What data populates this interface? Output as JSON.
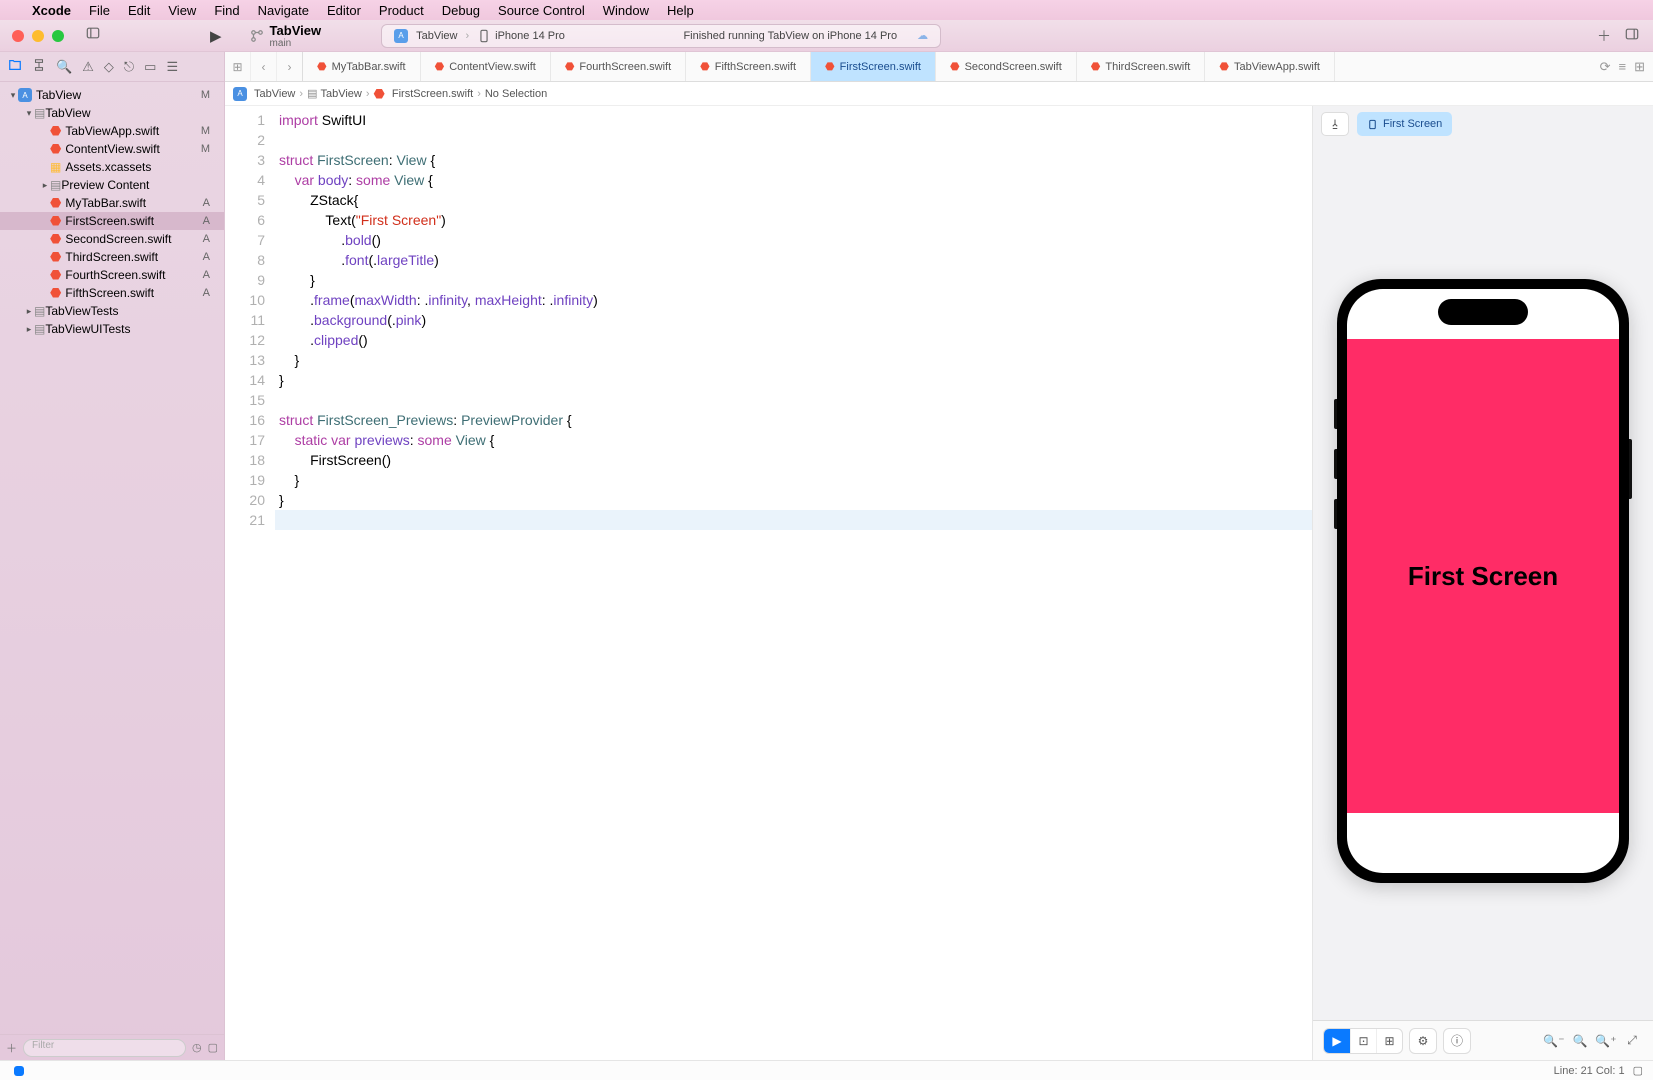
{
  "menu": {
    "app": "Xcode",
    "items": [
      "File",
      "Edit",
      "View",
      "Find",
      "Navigate",
      "Editor",
      "Product",
      "Debug",
      "Source Control",
      "Window",
      "Help"
    ]
  },
  "toolbar": {
    "scheme_name": "TabView",
    "scheme_branch": "main",
    "activity": {
      "target": "TabView",
      "device": "iPhone 14 Pro",
      "status": "Finished running TabView on iPhone 14 Pro"
    }
  },
  "navigator": {
    "tree": [
      {
        "level": 0,
        "disclosure": "▾",
        "kind": "proj",
        "name": "TabView",
        "scm": "M"
      },
      {
        "level": 1,
        "disclosure": "▾",
        "kind": "folder",
        "name": "TabView",
        "scm": ""
      },
      {
        "level": 2,
        "disclosure": "",
        "kind": "swift",
        "name": "TabViewApp.swift",
        "scm": "M"
      },
      {
        "level": 2,
        "disclosure": "",
        "kind": "swift",
        "name": "ContentView.swift",
        "scm": "M"
      },
      {
        "level": 2,
        "disclosure": "",
        "kind": "assets",
        "name": "Assets.xcassets",
        "scm": ""
      },
      {
        "level": 2,
        "disclosure": "▸",
        "kind": "folder",
        "name": "Preview Content",
        "scm": ""
      },
      {
        "level": 2,
        "disclosure": "",
        "kind": "swift",
        "name": "MyTabBar.swift",
        "scm": "A"
      },
      {
        "level": 2,
        "disclosure": "",
        "kind": "swift",
        "name": "FirstScreen.swift",
        "scm": "A",
        "selected": true
      },
      {
        "level": 2,
        "disclosure": "",
        "kind": "swift",
        "name": "SecondScreen.swift",
        "scm": "A"
      },
      {
        "level": 2,
        "disclosure": "",
        "kind": "swift",
        "name": "ThirdScreen.swift",
        "scm": "A"
      },
      {
        "level": 2,
        "disclosure": "",
        "kind": "swift",
        "name": "FourthScreen.swift",
        "scm": "A"
      },
      {
        "level": 2,
        "disclosure": "",
        "kind": "swift",
        "name": "FifthScreen.swift",
        "scm": "A"
      },
      {
        "level": 1,
        "disclosure": "▸",
        "kind": "folder",
        "name": "TabViewTests",
        "scm": ""
      },
      {
        "level": 1,
        "disclosure": "▸",
        "kind": "folder",
        "name": "TabViewUITests",
        "scm": ""
      }
    ],
    "filter_placeholder": "Filter"
  },
  "tabs": [
    {
      "name": "MyTabBar.swift"
    },
    {
      "name": "ContentView.swift"
    },
    {
      "name": "FourthScreen.swift"
    },
    {
      "name": "FifthScreen.swift"
    },
    {
      "name": "FirstScreen.swift",
      "active": true
    },
    {
      "name": "SecondScreen.swift"
    },
    {
      "name": "ThirdScreen.swift"
    },
    {
      "name": "TabViewApp.swift"
    }
  ],
  "breadcrumb": [
    "TabView",
    "TabView",
    "FirstScreen.swift",
    "No Selection"
  ],
  "code": {
    "lines": [
      [
        {
          "t": "import ",
          "c": "kw"
        },
        {
          "t": "SwiftUI"
        }
      ],
      [],
      [
        {
          "t": "struct ",
          "c": "kw"
        },
        {
          "t": "FirstScreen",
          "c": "typ"
        },
        {
          "t": ": "
        },
        {
          "t": "View",
          "c": "typ"
        },
        {
          "t": " {"
        }
      ],
      [
        {
          "t": "    "
        },
        {
          "t": "var ",
          "c": "kw"
        },
        {
          "t": "body",
          "c": "prop"
        },
        {
          "t": ": "
        },
        {
          "t": "some ",
          "c": "kw"
        },
        {
          "t": "View",
          "c": "typ"
        },
        {
          "t": " {"
        }
      ],
      [
        {
          "t": "        ZStack{"
        }
      ],
      [
        {
          "t": "            Text("
        },
        {
          "t": "\"First Screen\"",
          "c": "str"
        },
        {
          "t": ")"
        }
      ],
      [
        {
          "t": "                ."
        },
        {
          "t": "bold",
          "c": "prop"
        },
        {
          "t": "()"
        }
      ],
      [
        {
          "t": "                ."
        },
        {
          "t": "font",
          "c": "prop"
        },
        {
          "t": "(."
        },
        {
          "t": "largeTitle",
          "c": "prop"
        },
        {
          "t": ")"
        }
      ],
      [
        {
          "t": "        }"
        }
      ],
      [
        {
          "t": "        ."
        },
        {
          "t": "frame",
          "c": "prop"
        },
        {
          "t": "("
        },
        {
          "t": "maxWidth",
          "c": "prop"
        },
        {
          "t": ": ."
        },
        {
          "t": "infinity",
          "c": "prop"
        },
        {
          "t": ", "
        },
        {
          "t": "maxHeight",
          "c": "prop"
        },
        {
          "t": ": ."
        },
        {
          "t": "infinity",
          "c": "prop"
        },
        {
          "t": ")"
        }
      ],
      [
        {
          "t": "        ."
        },
        {
          "t": "background",
          "c": "prop"
        },
        {
          "t": "(."
        },
        {
          "t": "pink",
          "c": "prop"
        },
        {
          "t": ")"
        }
      ],
      [
        {
          "t": "        ."
        },
        {
          "t": "clipped",
          "c": "prop"
        },
        {
          "t": "()"
        }
      ],
      [
        {
          "t": "    }"
        }
      ],
      [
        {
          "t": "}"
        }
      ],
      [],
      [
        {
          "t": "struct ",
          "c": "kw"
        },
        {
          "t": "FirstScreen_Previews",
          "c": "typ"
        },
        {
          "t": ": "
        },
        {
          "t": "PreviewProvider",
          "c": "typ"
        },
        {
          "t": " {"
        }
      ],
      [
        {
          "t": "    "
        },
        {
          "t": "static ",
          "c": "kw"
        },
        {
          "t": "var ",
          "c": "kw"
        },
        {
          "t": "previews",
          "c": "prop"
        },
        {
          "t": ": "
        },
        {
          "t": "some ",
          "c": "kw"
        },
        {
          "t": "View",
          "c": "typ"
        },
        {
          "t": " {"
        }
      ],
      [
        {
          "t": "        FirstScreen()"
        }
      ],
      [
        {
          "t": "    }"
        }
      ],
      [
        {
          "t": "}"
        }
      ],
      []
    ],
    "cursor_line": 21
  },
  "preview": {
    "chip_label": "First Screen",
    "app_text": "First Screen",
    "bg_color": "#ff2c66"
  },
  "status": {
    "cursor": "Line: 21  Col: 1"
  }
}
